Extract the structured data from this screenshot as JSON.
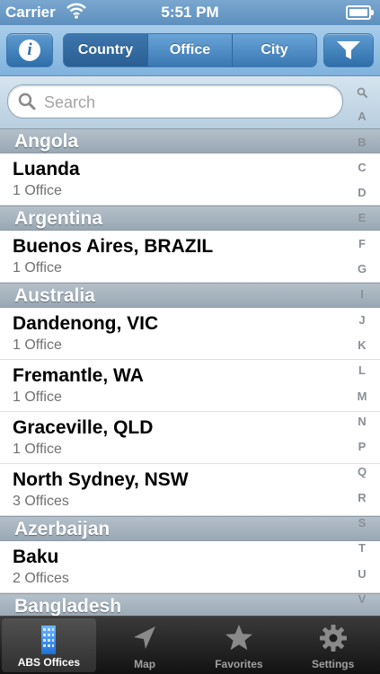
{
  "status_bar": {
    "carrier": "Carrier",
    "time": "5:51 PM"
  },
  "nav_bar": {
    "segments": [
      {
        "label": "Country",
        "selected": true
      },
      {
        "label": "Office",
        "selected": false
      },
      {
        "label": "City",
        "selected": false
      }
    ],
    "left_icon": "info-icon",
    "right_icon": "filter-funnel-icon"
  },
  "search": {
    "placeholder": "Search",
    "value": ""
  },
  "sections": [
    {
      "header": "Angola",
      "rows": [
        {
          "title": "Luanda",
          "subtitle": "1 Office"
        }
      ]
    },
    {
      "header": "Argentina",
      "rows": [
        {
          "title": "Buenos Aires, BRAZIL",
          "subtitle": "1 Office"
        }
      ]
    },
    {
      "header": "Australia",
      "rows": [
        {
          "title": "Dandenong, VIC",
          "subtitle": "1 Office"
        },
        {
          "title": "Fremantle, WA",
          "subtitle": "1 Office"
        },
        {
          "title": "Graceville, QLD",
          "subtitle": "1 Office"
        },
        {
          "title": "North Sydney, NSW",
          "subtitle": "3 Offices"
        }
      ]
    },
    {
      "header": "Azerbaijan",
      "rows": [
        {
          "title": "Baku",
          "subtitle": "2 Offices"
        }
      ]
    },
    {
      "header": "Bangladesh",
      "rows": []
    }
  ],
  "index_letters": [
    "A",
    "B",
    "C",
    "D",
    "E",
    "F",
    "G",
    "I",
    "J",
    "K",
    "L",
    "M",
    "N",
    "P",
    "Q",
    "R",
    "S",
    "T",
    "U",
    "V"
  ],
  "tab_bar": {
    "tabs": [
      {
        "label": "ABS Offices",
        "icon": "building-icon",
        "active": true
      },
      {
        "label": "Map",
        "icon": "location-arrow-icon",
        "active": false
      },
      {
        "label": "Favorites",
        "icon": "star-icon",
        "active": false
      },
      {
        "label": "Settings",
        "icon": "gear-icon",
        "active": false
      }
    ]
  },
  "colors": {
    "nav_blue": "#3a78b3",
    "section_gray": "#9aa8b4",
    "tab_bar_dark": "#121212"
  }
}
